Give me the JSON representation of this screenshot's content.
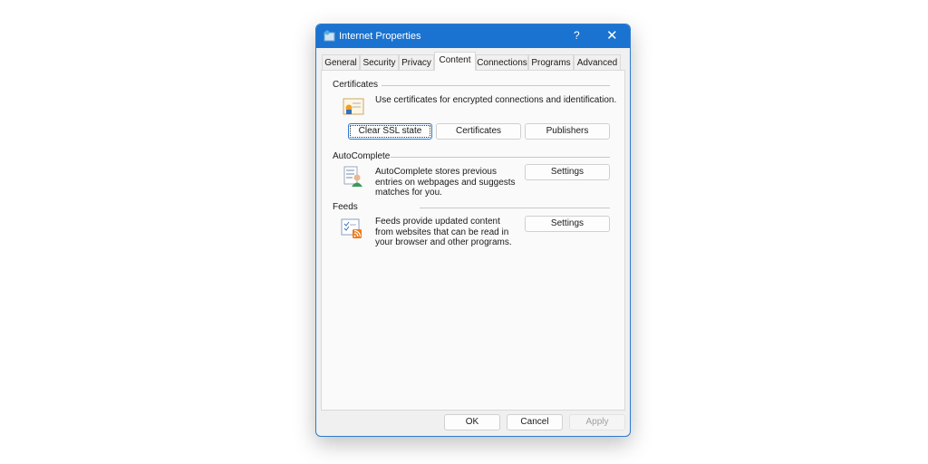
{
  "window": {
    "title": "Internet Properties",
    "help": "?",
    "close": "✕"
  },
  "tabs": [
    "General",
    "Security",
    "Privacy",
    "Content",
    "Connections",
    "Programs",
    "Advanced"
  ],
  "selected_tab": "Content",
  "certificates": {
    "heading": "Certificates",
    "description": "Use certificates for encrypted connections and identification.",
    "buttons": [
      "Clear SSL state",
      "Certificates",
      "Publishers"
    ]
  },
  "autocomplete": {
    "heading": "AutoComplete",
    "description": "AutoComplete stores previous entries on webpages and suggests matches for you.",
    "settings": "Settings"
  },
  "feeds": {
    "heading": "Feeds",
    "description": "Feeds provide updated content from websites that can be read in your browser and other programs.",
    "settings": "Settings"
  },
  "footer": {
    "ok": "OK",
    "cancel": "Cancel",
    "apply": "Apply"
  },
  "colors": {
    "titlebar": "#1a73d0",
    "rss": "#f07a1a"
  }
}
